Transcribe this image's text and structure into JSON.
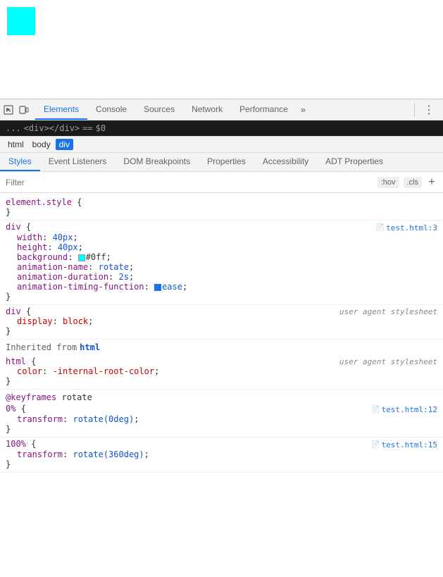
{
  "preview": {
    "cyan_box_color": "#00ffff"
  },
  "devtools": {
    "toolbar": {
      "inspect_icon": "⊡",
      "device_icon": "▭",
      "tabs": [
        {
          "label": "Elements",
          "active": true
        },
        {
          "label": "Console",
          "active": false
        },
        {
          "label": "Sources",
          "active": false
        },
        {
          "label": "Network",
          "active": false
        },
        {
          "label": "Performance",
          "active": false
        }
      ],
      "more_label": "»",
      "menu_label": "⋮"
    },
    "breadcrumb": {
      "ellipsis": "...",
      "html": "<div></div>",
      "equals": "==",
      "dollar": "$0"
    },
    "element_path": [
      {
        "label": "html",
        "active": false
      },
      {
        "label": "body",
        "active": false
      },
      {
        "label": "div",
        "active": true
      }
    ],
    "panel_tabs": [
      {
        "label": "Styles",
        "active": true
      },
      {
        "label": "Event Listeners",
        "active": false
      },
      {
        "label": "DOM Breakpoints",
        "active": false
      },
      {
        "label": "Properties",
        "active": false
      },
      {
        "label": "Accessibility",
        "active": false
      },
      {
        "label": "ADT Properties",
        "active": false
      }
    ],
    "filter": {
      "placeholder": "Filter",
      "hov_label": ":hov",
      "cls_label": ".cls",
      "add_label": "+"
    },
    "styles": {
      "blocks": [
        {
          "type": "rule",
          "selector": "element.style",
          "source": null,
          "properties": [],
          "open_brace": " {",
          "close_brace": "}"
        },
        {
          "type": "rule",
          "selector": "div",
          "source": "test.html:3",
          "open_brace": " {",
          "close_brace": "}",
          "properties": [
            {
              "name": "width",
              "value": "40px",
              "type": "normal"
            },
            {
              "name": "height",
              "value": "40px",
              "type": "normal"
            },
            {
              "name": "background",
              "value": "#0ff",
              "type": "color",
              "color": "#00ffff"
            },
            {
              "name": "animation-name",
              "value": "rotate",
              "type": "normal"
            },
            {
              "name": "animation-duration",
              "value": "2s",
              "type": "normal"
            },
            {
              "name": "animation-timing-function",
              "value": "ease",
              "type": "checkbox"
            }
          ]
        },
        {
          "type": "rule",
          "selector": "div",
          "source": "user agent stylesheet",
          "source_type": "ua",
          "open_brace": " {",
          "close_brace": "}",
          "properties": [
            {
              "name": "display",
              "value": "block",
              "type": "normal"
            }
          ]
        },
        {
          "type": "inherited",
          "label": "Inherited from",
          "tag": "html"
        },
        {
          "type": "rule",
          "selector": "html",
          "source": "user agent stylesheet",
          "source_type": "ua",
          "open_brace": " {",
          "close_brace": "}",
          "properties": [
            {
              "name": "color",
              "value": "-internal-root-color",
              "type": "normal"
            }
          ]
        },
        {
          "type": "keyframes",
          "label": "@keyframes rotate"
        },
        {
          "type": "keyframe_stop",
          "selector": "0%",
          "source": "test.html:12",
          "open_brace": " {",
          "close_brace": "}",
          "properties": [
            {
              "name": "transform",
              "value": "rotate(0deg)",
              "type": "normal"
            }
          ]
        },
        {
          "type": "keyframe_stop",
          "selector": "100%",
          "source": "test.html:15",
          "open_brace": " {",
          "close_brace": "}",
          "properties": [
            {
              "name": "transform",
              "value": "rotate(360deg)",
              "type": "normal"
            }
          ]
        }
      ]
    }
  }
}
